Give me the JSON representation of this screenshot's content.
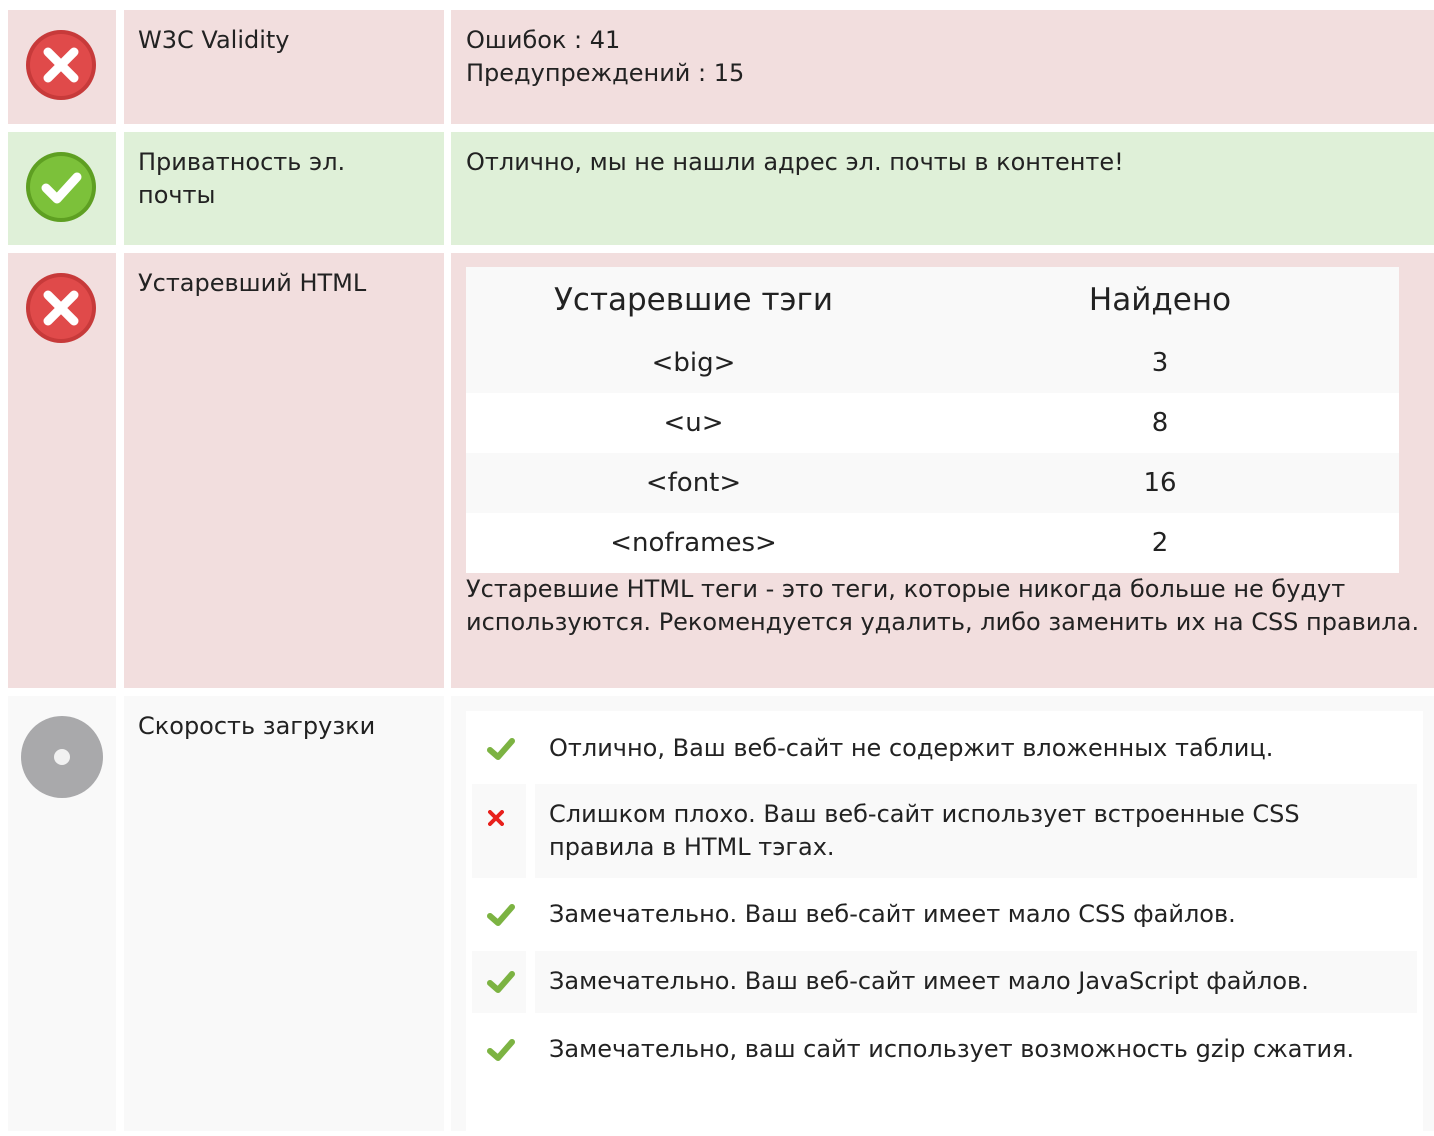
{
  "colors": {
    "bad_bg": "#f2dede",
    "good_bg": "#dff0d8",
    "neutral_bg": "#f9f9f9",
    "error_red": "#e04a4a",
    "ok_green": "#7cc13a",
    "neutral_gray": "#a9a9ab"
  },
  "rows": {
    "w3c": {
      "status": "error",
      "label": "W3C Validity",
      "errors": "Ошибок : 41",
      "warnings": "Предупреждений : 15"
    },
    "email": {
      "status": "ok",
      "label": "Приватность эл. почты",
      "message": "Отлично, мы не нашли адрес эл. почты в контенте!"
    },
    "deprecated": {
      "status": "error",
      "label": "Устаревший HTML",
      "table_headers": [
        "Устаревшие тэги",
        "Найдено"
      ],
      "table_rows": [
        {
          "tag": "<big>",
          "count": "3"
        },
        {
          "tag": "<u>",
          "count": "8"
        },
        {
          "tag": "<font>",
          "count": "16"
        },
        {
          "tag": "<noframes>",
          "count": "2"
        }
      ],
      "note": "Устаревшие HTML теги - это теги, которые никогда больше не будут используются. Рекомендуется удалить, либо заменить их на CSS правила."
    },
    "speed": {
      "status": "neutral",
      "label": "Скорость загрузки",
      "items": [
        {
          "icon": "check-icon",
          "text": "Отлично, Ваш веб-сайт не содержит вложенных таблиц."
        },
        {
          "icon": "cross-icon",
          "text": "Слишком плохо. Ваш веб-сайт использует встроенные CSS правила в HTML тэгах."
        },
        {
          "icon": "check-icon",
          "text": "Замечательно. Ваш веб-сайт имеет мало CSS файлов."
        },
        {
          "icon": "check-icon",
          "text": "Замечательно. Ваш веб-сайт имеет мало JavaScript файлов."
        },
        {
          "icon": "check-icon",
          "text": "Замечательно, ваш сайт использует возможность gzip сжатия."
        }
      ]
    }
  }
}
